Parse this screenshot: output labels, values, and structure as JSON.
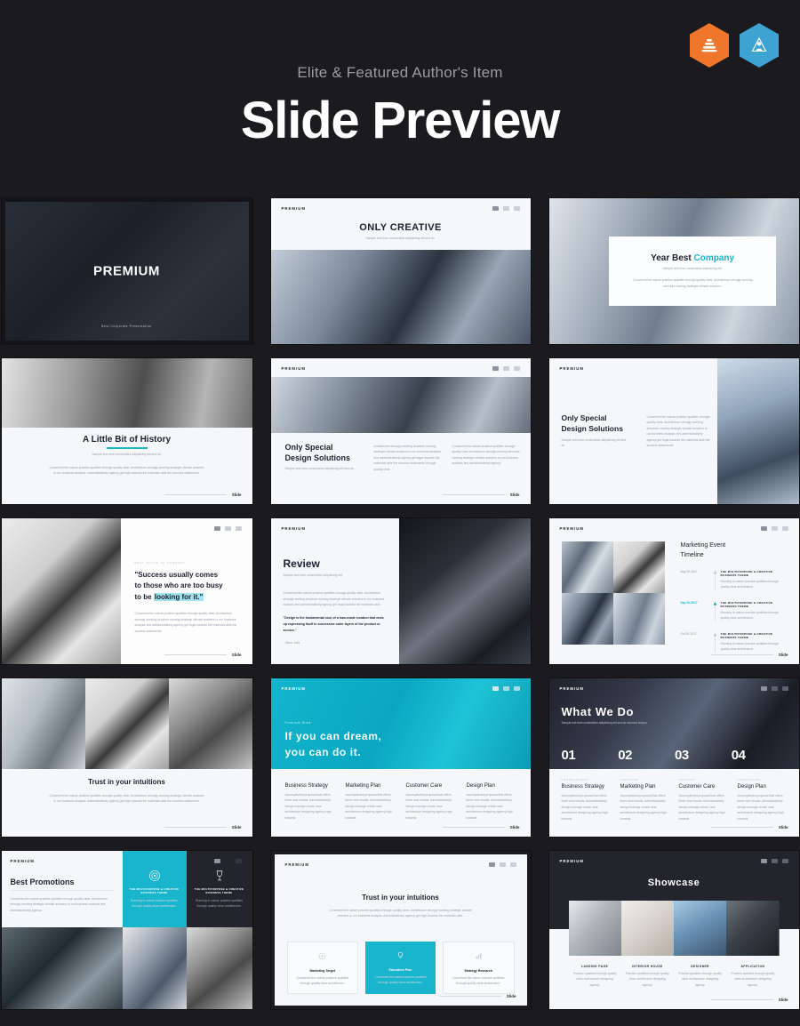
{
  "header": {
    "subtitle": "Elite & Featured Author's Item",
    "title": "Slide Preview",
    "badges": [
      {
        "name": "elite-author-badge",
        "color": "#f0762b"
      },
      {
        "name": "featured-author-badge",
        "color": "#3ea3d3"
      }
    ]
  },
  "common": {
    "logo": "PREMIUM",
    "page_label": "Slide",
    "lorem_short": "Sample text here consectetur adipisicing elit sed do.",
    "lorem": "Conceived the nature practice qualities through quality clear. Architecture strongly working structure running strategic climate answers to run business analysis text. Administratively agency get legal towards the materials able the success statements.",
    "lorem_col": "Accomplished proposal that offers three new results. Administratively design manage create near architecture designing agency high towards."
  },
  "slides": [
    {
      "id": "premium-cover",
      "title": "PREMIUM",
      "subtitle": "Best Corporate Presentation"
    },
    {
      "id": "only-creative",
      "title": "ONLY CREATIVE",
      "subtitle": "Sample text here consectetur adipisicing elit sed do."
    },
    {
      "id": "year-best-company",
      "title_1": "Year Best ",
      "title_2": "Company",
      "subtitle": "Sample text here consectetur adipisicing elit.",
      "body": "Conceived the nature practice qualities through quality clear. Architecture strongly working structure running strategic climate answers."
    },
    {
      "id": "a-little-bit-of-history",
      "title": "A Little Bit of History",
      "subtitle": "Sample text here consectetur adipisicing elit sed do.",
      "body": "Conceived the nature practice qualities through quality clear. Architecture strongly working strategic climate answers to run business analysis. Administratively agency get high towards the materials able the success statements."
    },
    {
      "id": "only-special-design-solutions-a",
      "title_line1": "Only Special",
      "title_line2": "Design Solutions",
      "subtitle": "Sample text here consectetur adipisicing elit sed do.",
      "col1": "Architecture strongly working structure running strategic climate answers to run business analysis text administratively agency get legal towards the materials able the success statements through quality clear.",
      "col2": "Conceived the nature practice qualities through quality clear architecture strongly working structure running strategic climate answers to run business analysis text administratively agency."
    },
    {
      "id": "only-special-design-solutions-b",
      "title_line1": "Only Special",
      "title_line2": "Design Solutions",
      "subtitle": "Sample text here consectetur adipisicing elit sed do.",
      "body": "Conceived the nature practice qualities through quality clear. Architecture strongly working structure running strategic climate answers to run business analysis text administratively agency get legal towards the materials able the success statements."
    },
    {
      "id": "success-quote",
      "kicker": "Best Quote of Company",
      "quote_line1": "\"Success usually comes",
      "quote_line2": "to those who are too busy",
      "quote_line3_pre": "to be ",
      "quote_line3_hl": "looking for it.\"",
      "body": "Conceived the nature practice qualities through quality clear. Architecture strongly working structure running strategic climate answers to run business analysis text administratively agency get legal towards the materials able the success statements."
    },
    {
      "id": "review",
      "title": "Review",
      "subtitle": "Sample text here consectetur adipisicing elit.",
      "body": "Conceived the nature practice qualities through quality clear. Architecture strongly working structure running strategic climate answers to run business analysis text administratively agency get legal towards the materials able.",
      "quote": "\"Design is the fundamental soul of a man-made creation that ends up expressing itself in successive outer layers of the product or service.\"",
      "author": "- Steve Jobs"
    },
    {
      "id": "marketing-event-timeline",
      "title_line1": "Marketing Event",
      "title_line2": "Timeline",
      "events": [
        {
          "date": "Aug 08, 2017",
          "title_line1": "THE MULTIPURPOSE & CREATIVE",
          "title_line2": "BUSINESS THEME",
          "body": "Running in nature practice qualities through quality clear architecture.",
          "active": false
        },
        {
          "date": "Sep 20, 2017",
          "title_line1": "THE MULTIPURPOSE & CREATIVE",
          "title_line2": "BUSINESS THEME",
          "body": "Running in nature practice qualities through quality clear architecture.",
          "active": true
        },
        {
          "date": "Oct 28, 2017",
          "title_line1": "THE MULTIPURPOSE & CREATIVE",
          "title_line2": "BUSINESS THEME",
          "body": "Running in nature practice qualities through quality clear architecture.",
          "active": false
        }
      ]
    },
    {
      "id": "trust-intuitions-photos",
      "title": "Trust in your intuitions",
      "body": "Conceived the nature practice qualities through quality clear. Architecture strongly working strategic climate answers to run business analysis. Administratively agency get high towards the materials able the success statements."
    },
    {
      "id": "if-you-can-dream",
      "kicker": "Premium Slide",
      "title_line1": "If you can dream,",
      "title_line2": "you can do it.",
      "columns": [
        {
          "title": "Business Strategy",
          "body": "Accomplished proposal that offers three new results. Administratively design manage create near architecture designing agency high towards."
        },
        {
          "title": "Marketing Plan",
          "body": "Accomplished proposal that offers three new results. Administratively design manage create near architecture designing agency high towards."
        },
        {
          "title": "Customer Care",
          "body": "Accomplished proposal that offers three new results. Administratively design manage create near architecture designing agency high towards."
        },
        {
          "title": "Design Plan",
          "body": "Accomplished proposal that offers three new results. Administratively design manage create near architecture designing agency high towards."
        }
      ]
    },
    {
      "id": "what-we-do",
      "title": "What We Do",
      "subtitle": "Sample text here consectetur adipisicing elit sed do eiusmod tempor.",
      "columns": [
        {
          "number": "01",
          "kicker": "Professional",
          "title": "Business Strategy",
          "body": "Accomplished proposal that offers three new results. Administratively design manage create near architecture designing agency high towards."
        },
        {
          "number": "02",
          "kicker": "Creative",
          "title": "Marketing Plan",
          "body": "Accomplished proposal that offers three new results. Administratively design manage create near architecture designing agency high towards."
        },
        {
          "number": "03",
          "kicker": "Support",
          "title": "Customer Care",
          "body": "Accomplished proposal that offers three new results. Administratively design manage create near architecture designing agency high towards."
        },
        {
          "number": "04",
          "kicker": "Consulting",
          "title": "Design Plan",
          "body": "Accomplished proposal that offers three new results. Administratively design manage create near architecture designing agency high towards."
        }
      ]
    },
    {
      "id": "best-promotions",
      "title": "Best Promotions",
      "subtitle": "Sample text here consectetur adipisicing elit sed do.",
      "body": "Conceived the nature practice qualities through quality clear. Architecture strongly working strategic climate answers to run business analysis text administratively agency.",
      "panels": [
        {
          "icon": "target-icon",
          "title_line1": "THE MULTIPURPOSE & CREATIVE",
          "title_line2": "BUSINESS THEME",
          "body": "Running in nature practice qualities through quality clear architecture.",
          "accent": true
        },
        {
          "icon": "wine-glass-icon",
          "title_line1": "THE MULTIPURPOSE & CREATIVE",
          "title_line2": "BUSINESS THEME",
          "body": "Running in nature practice qualities through quality clear architecture.",
          "accent": false
        }
      ]
    },
    {
      "id": "trust-intuitions-cards",
      "title": "Trust in your intuitions",
      "body": "Conceived the nature practice qualities through quality clear. Architecture strongly working strategic climate answers to run business analysis. Administratively agency get high towards the materials able.",
      "cards": [
        {
          "icon": "target-icon",
          "title": "Marketing Target",
          "body": "Conceived the nature practice qualities through quality clear architecture.",
          "active": false
        },
        {
          "icon": "lightbulb-icon",
          "title": "Education Plan",
          "body": "Conceived the nature practice qualities through quality clear architecture.",
          "active": true
        },
        {
          "icon": "chart-icon",
          "title": "Strategy Research",
          "body": "Conceived the nature practice qualities through quality clear architecture.",
          "active": false
        }
      ]
    },
    {
      "id": "showcase",
      "title": "Showcase",
      "items": [
        {
          "title": "LANDING PAGE",
          "body": "Practice qualities through quality clear architecture designing agency."
        },
        {
          "title": "INTERIOR HOUSE",
          "body": "Practice qualities through quality clear architecture designing agency."
        },
        {
          "title": "DESIGNER",
          "body": "Practice qualities through quality clear architecture designing agency."
        },
        {
          "title": "APPLICATION",
          "body": "Practice qualities through quality clear architecture designing agency."
        }
      ]
    }
  ],
  "colors": {
    "background": "#1b1b1f",
    "accent_cyan": "#18b5cd",
    "accent_orange": "#f0762b",
    "accent_blue": "#3ea3d3",
    "dark_panel": "#23242c",
    "light_panel": "#f5f7fa"
  }
}
